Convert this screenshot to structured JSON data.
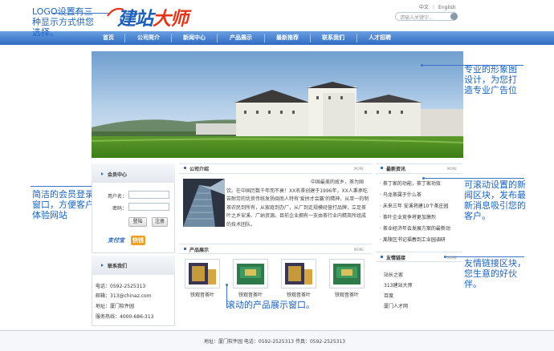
{
  "logo": {
    "main": "建站",
    "accent": "大师"
  },
  "header": {
    "lang_cn": "中文",
    "lang_sep": "|",
    "lang_en": "English",
    "search_placeholder": "请输入关键字..."
  },
  "nav": {
    "items": [
      "首页",
      "公司简介",
      "新闻中心",
      "产品展示",
      "最新推荐",
      "联系我们",
      "人才招聘"
    ]
  },
  "annotations": {
    "logo": "LOGO设置有三种显示方式供您选择。",
    "banner": "专业的形象图设计，为您打造专业广告位",
    "member": "简洁的会员登录窗口，方便客户体验网站",
    "news": "可滚动设置的新闻区块，发布最新消息吸引您的客户。",
    "links": "友情链接区块，您生意的好伙伴。",
    "products": "滚动的产品展示窗口。"
  },
  "member": {
    "title": "会员中心",
    "username_label": "用户名：",
    "password_label": "密码：",
    "login_button": "登陆",
    "register_button": "注册",
    "pay_badges": [
      "支付宝",
      "快钱"
    ]
  },
  "contact": {
    "title": "联系我们",
    "lines": [
      "电话：0592-2525313",
      "邮箱：313@chinaz.com",
      "地址：厦门软件园",
      "服务热线：4000-686-313"
    ]
  },
  "company": {
    "title": "公司介绍",
    "more": "MORE",
    "text": "中国最美的故乡，茶为国饮。在中国历数千年而不衰！XX名茶创建于1996年，XX人秉承吃苦耐劳的优良传统发扬闽南人特有'爱拼才会赢'的精神，从单一的制茶农民到所有，从家庭到办厂，从厂到走规模经营打品牌，立足茶叶之乡安溪、广纳资源。目前企业拥有一支由茶行业内精英所组成的技术团队。"
  },
  "products": {
    "title": "产品展示",
    "more": "MORE",
    "items": [
      "铁观音茶叶",
      "铁观音茶叶",
      "铁观音茶叶",
      "铁观音茶叶"
    ]
  },
  "news": {
    "title": "最新资讯",
    "more": "MORE",
    "items": [
      "茶丁家的功能，茶丁家功效",
      "乌龙茶属于什么茶",
      "未来三年 安溪将建10个茶庄园",
      "茶叶企业竞争将更加激烈",
      "茶业经济年会发展方案的最新动",
      "离陵区书记福春到工业园调研"
    ]
  },
  "links": {
    "title": "友情链接",
    "more": "MORE",
    "items": [
      "站长之家",
      "313建站大师",
      "百度",
      "厦门人才网"
    ]
  },
  "footer": {
    "text": "地址：厦门软件园    电话：0592-2525313    传真：0592-2525313"
  }
}
